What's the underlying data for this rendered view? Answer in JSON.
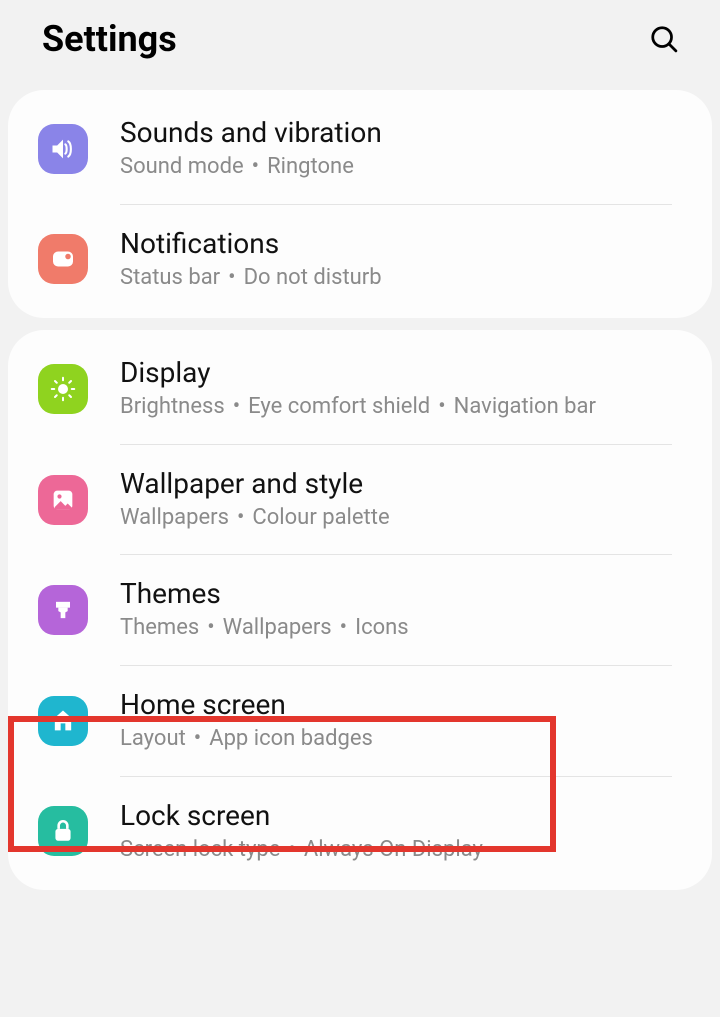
{
  "header": {
    "title": "Settings"
  },
  "groups": [
    {
      "items": [
        {
          "iconName": "volume-icon",
          "iconBg": "#8a84e8",
          "title": "Sounds and vibration",
          "subs": [
            "Sound mode",
            "Ringtone"
          ]
        },
        {
          "iconName": "pip-icon",
          "iconBg": "#f07b6a",
          "title": "Notifications",
          "subs": [
            "Status bar",
            "Do not disturb"
          ]
        }
      ]
    },
    {
      "items": [
        {
          "iconName": "sun-icon",
          "iconBg": "#8fd31f",
          "title": "Display",
          "subs": [
            "Brightness",
            "Eye comfort shield",
            "Navigation bar"
          ]
        },
        {
          "iconName": "picture-icon",
          "iconBg": "#ed6897",
          "title": "Wallpaper and style",
          "subs": [
            "Wallpapers",
            "Colour palette"
          ]
        },
        {
          "iconName": "brush-icon",
          "iconBg": "#b565d9",
          "title": "Themes",
          "subs": [
            "Themes",
            "Wallpapers",
            "Icons"
          ]
        },
        {
          "iconName": "home-icon",
          "iconBg": "#1fb6cf",
          "title": "Home screen",
          "subs": [
            "Layout",
            "App icon badges"
          ]
        },
        {
          "iconName": "lock-icon",
          "iconBg": "#26bda0",
          "title": "Lock screen",
          "subs": [
            "Screen lock type",
            "Always On Display"
          ]
        }
      ]
    }
  ]
}
